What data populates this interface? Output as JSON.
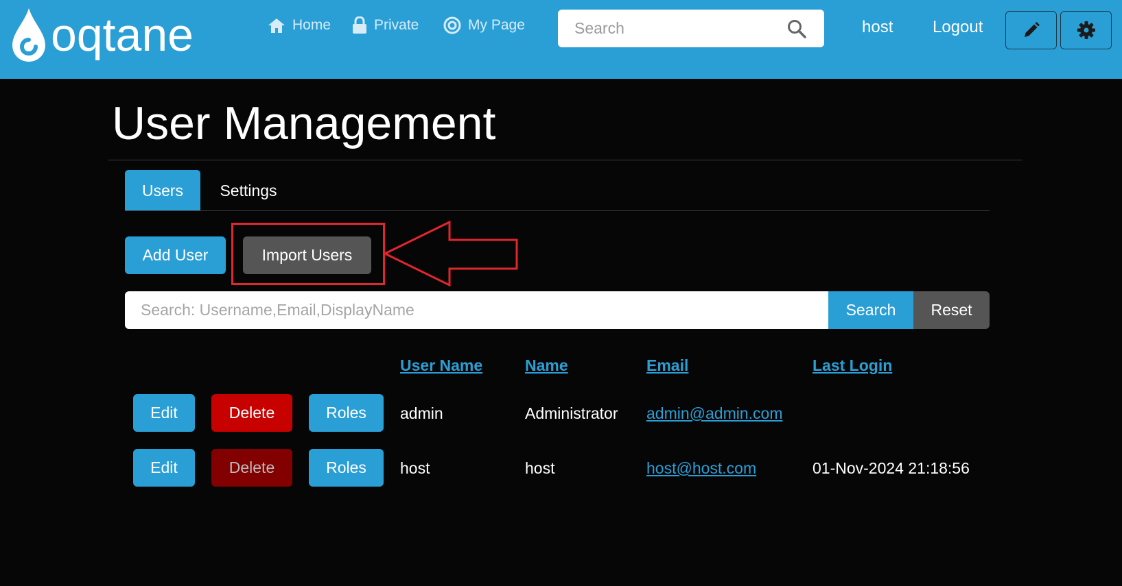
{
  "header": {
    "logo_text": "oqtane",
    "nav": [
      {
        "label": "Home",
        "icon": "home-icon"
      },
      {
        "label": "Private",
        "icon": "lock-icon"
      },
      {
        "label": "My Page",
        "icon": "target-icon"
      }
    ],
    "search": {
      "placeholder": "Search",
      "value": ""
    },
    "user_label": "host",
    "logout_label": "Logout",
    "edit_icon": "pencil-icon",
    "settings_icon": "gear-icon"
  },
  "page": {
    "title": "User Management",
    "tabs": [
      {
        "label": "Users",
        "active": true
      },
      {
        "label": "Settings",
        "active": false
      }
    ],
    "add_user_label": "Add User",
    "import_users_label": "Import Users",
    "user_search": {
      "placeholder": "Search: Username,Email,DisplayName",
      "value": ""
    },
    "search_label": "Search",
    "reset_label": "Reset"
  },
  "table": {
    "columns": [
      "User Name",
      "Name",
      "Email",
      "Last Login"
    ],
    "action_labels": {
      "edit": "Edit",
      "delete": "Delete",
      "roles": "Roles"
    },
    "rows": [
      {
        "username": "admin",
        "name": "Administrator",
        "email": "admin@admin.com",
        "last_login": "",
        "delete_enabled": true
      },
      {
        "username": "host",
        "name": "host",
        "email": "host@host.com",
        "last_login": "01-Nov-2024 21:18:56",
        "delete_enabled": false
      }
    ]
  },
  "colors": {
    "brand": "#2a9fd6",
    "background": "#060606",
    "delete": "#c70000",
    "delete_disabled": "#820000",
    "secondary": "#555555",
    "annotation": "#e1262d"
  }
}
